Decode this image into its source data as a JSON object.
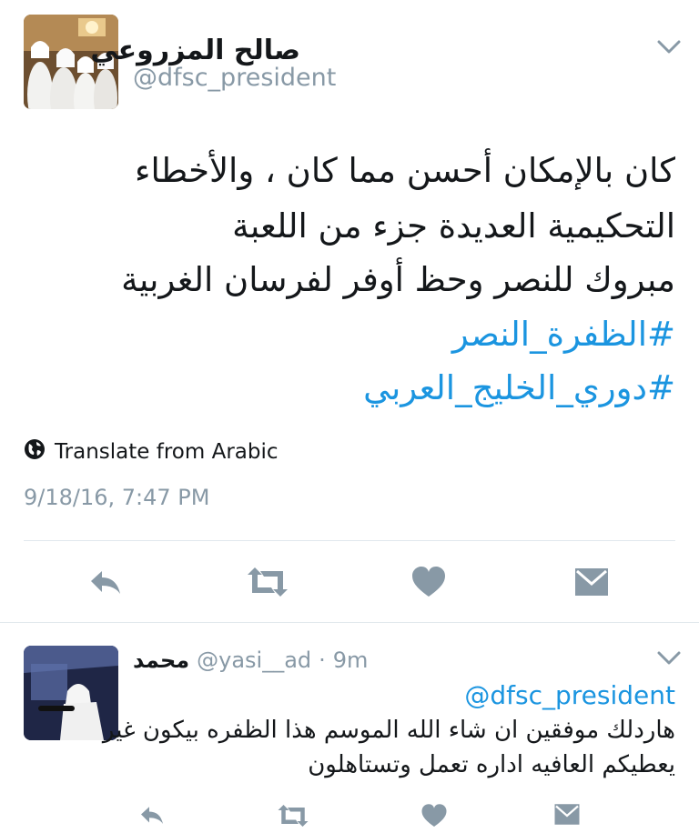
{
  "main_tweet": {
    "author": {
      "display_name": "صالح المزروعي",
      "handle": "@dfsc_president"
    },
    "text_lines": [
      "كان بالإمكان أحسن مما كان ، والأخطاء",
      "التحكيمية العديدة جزء من اللعبة",
      "مبروك للنصر وحظ أوفر لفرسان الغربية"
    ],
    "hashtags": [
      "#الظفرة_النصر",
      "#دوري_الخليج_العربي"
    ],
    "translate_label": "Translate from Arabic",
    "timestamp": "9/18/16, 7:47 PM",
    "actions": [
      "reply-icon",
      "retweet-icon",
      "like-icon",
      "message-icon"
    ]
  },
  "reply": {
    "display_name": "محمد",
    "handle": "@yasi__ad",
    "separator": "·",
    "time_ago": "9m",
    "mention": "@dfsc_president",
    "text_lines": [
      "هاردلك موفقين ان شاء الله الموسم هذا الظفره بيكون غير",
      "يعطيكم العافيه اداره تعمل وتستاهلون"
    ],
    "actions": [
      "reply-icon",
      "retweet-icon",
      "like-icon",
      "message-icon"
    ]
  },
  "colors": {
    "hashtag": "#1b95e0",
    "secondary_text": "#8899a6",
    "icon": "#8899a6",
    "divider": "#e1e8ed"
  }
}
